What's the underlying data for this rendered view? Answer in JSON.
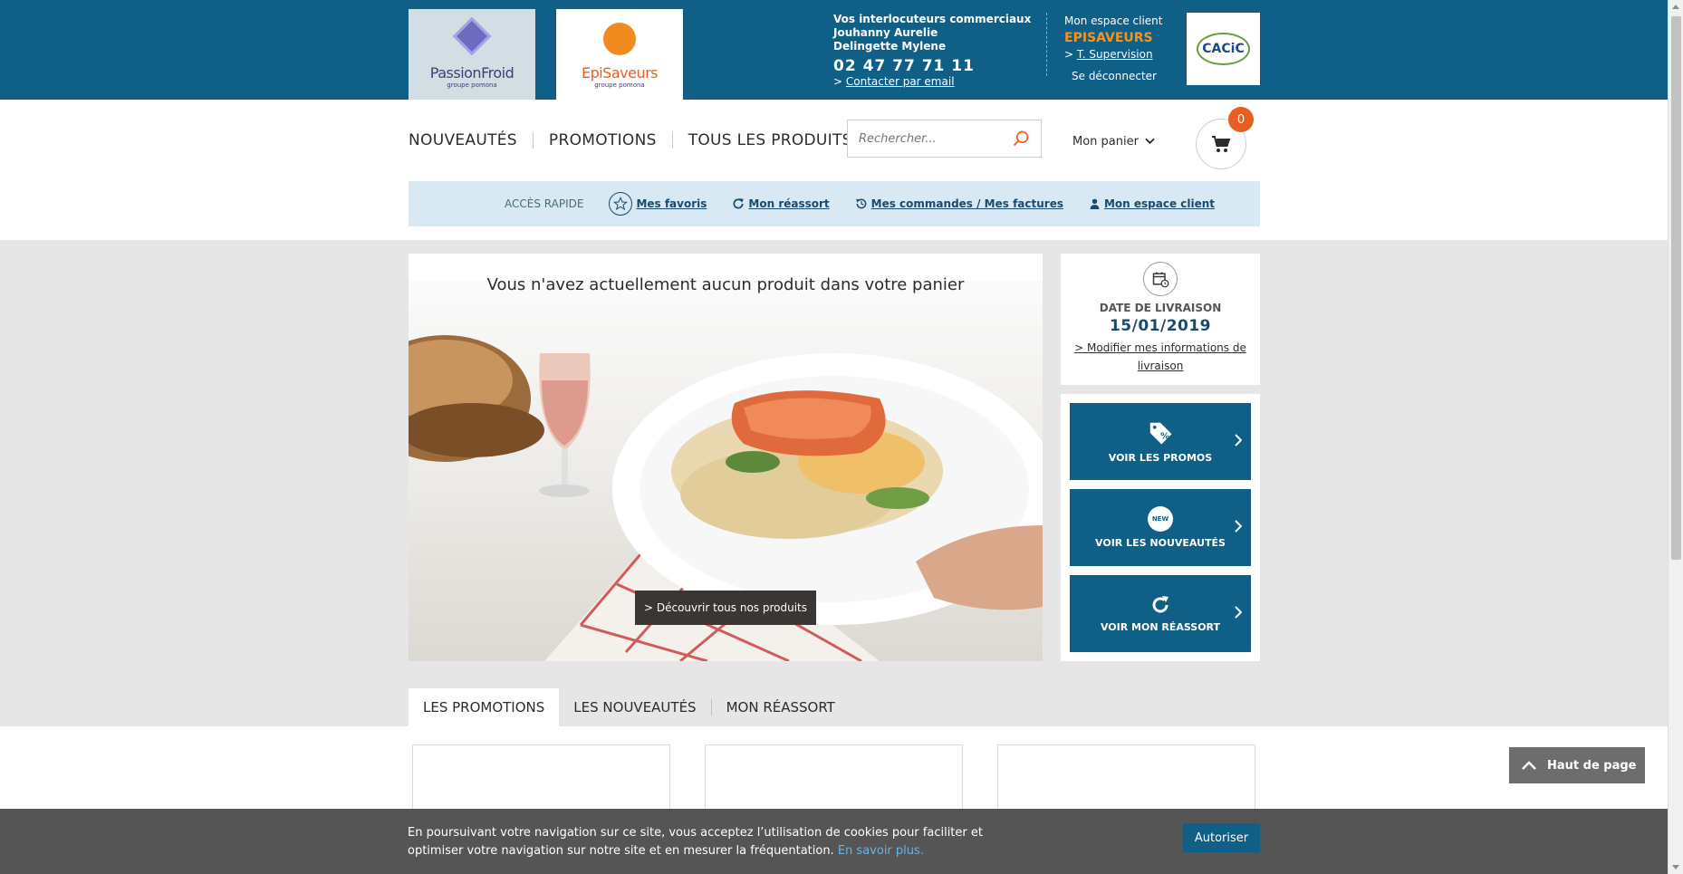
{
  "header": {
    "logo_passionfroid": {
      "name": "PassionFroid",
      "sub": "groupe pomona"
    },
    "logo_episaveurs": {
      "name": "EpiSaveurs",
      "sub": "groupe pomona"
    },
    "contact": {
      "title": "Vos interlocuteurs commerciaux",
      "person1": "Jouhanny Aurelie",
      "person2": "Delingette Mylene",
      "phone": "02 47 77 71 11",
      "email_prefix": ">",
      "email_label": "Contacter par email"
    },
    "account": {
      "title": "Mon espace client",
      "brand": "EPISAVEURS",
      "supervision_prefix": ">",
      "supervision_label": "T. Supervision",
      "logout_label": "Se déconnecter"
    },
    "partner_logo": "CACiC"
  },
  "nav": {
    "items": [
      "NOUVEAUTÉS",
      "PROMOTIONS",
      "TOUS LES PRODUITS"
    ],
    "search_placeholder": "Rechercher...",
    "cart_label": "Mon panier",
    "cart_count": "0"
  },
  "quick_access": {
    "title": "ACCÈS RAPIDE",
    "links": [
      "Mes favoris",
      "Mon réassort",
      "Mes commandes / Mes factures",
      "Mon espace client"
    ]
  },
  "hero": {
    "title": "Vous n'avez actuellement aucun produit dans votre panier",
    "button": "> Découvrir tous nos produits"
  },
  "delivery": {
    "label": "DATE DE LIVRAISON",
    "date": "15/01/2019",
    "link_prefix": ">",
    "link": " Modifier mes informations de livraison"
  },
  "side_buttons": [
    "VOIR LES PROMOS",
    "VOIR LES NOUVEAUTÉS",
    "VOIR MON RÉASSORT"
  ],
  "new_badge": "NEW",
  "tabs": [
    "LES PROMOTIONS",
    "LES NOUVEAUTÉS",
    "MON RÉASSORT"
  ],
  "back_to_top": "Haut de page",
  "cookie": {
    "text": "En poursuivant votre navigation sur ce site, vous acceptez l’utilisation de cookies pour faciliter et optimiser votre navigation sur notre site et en mesurer la fréquentation.",
    "link": "En savoir plus.",
    "accept": "Autoriser"
  },
  "colors": {
    "primary_blue": "#0f5f87",
    "accent_orange": "#e85d20",
    "brand_orange": "#f39321",
    "quick_bg": "#d8e9f3"
  },
  "icons": [
    "search-icon",
    "chevron-down-icon",
    "cart-icon",
    "star-icon",
    "refresh-icon",
    "history-icon",
    "user-icon",
    "calendar-icon",
    "percent-tag-icon",
    "new-badge-icon",
    "chevron-right-icon",
    "chevron-up-icon"
  ]
}
